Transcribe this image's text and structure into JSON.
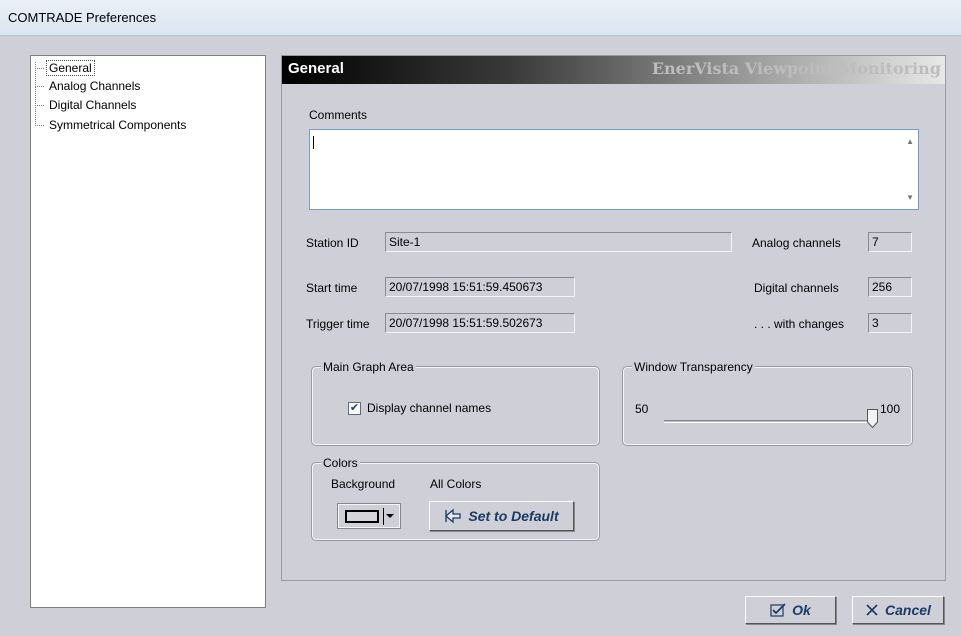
{
  "window": {
    "title": "COMTRADE Preferences"
  },
  "tree": {
    "items": [
      {
        "label": "General"
      },
      {
        "label": "Analog Channels"
      },
      {
        "label": "Digital Channels"
      },
      {
        "label": "Symmetrical Components"
      }
    ]
  },
  "banner": {
    "title": "General",
    "brand": "EnerVista Viewpoint Monitoring"
  },
  "comments": {
    "label": "Comments",
    "value": ""
  },
  "station": {
    "label": "Station ID",
    "value": "Site-1"
  },
  "start": {
    "label": "Start time",
    "value": "20/07/1998 15:51:59.450673"
  },
  "trigger": {
    "label": "Trigger time",
    "value": "20/07/1998 15:51:59.502673"
  },
  "analog": {
    "label": "Analog channels",
    "value": "7"
  },
  "digital": {
    "label": "Digital channels",
    "value": "256"
  },
  "changes": {
    "label": ". . . with changes",
    "value": "3"
  },
  "main_graph": {
    "legend": "Main Graph Area",
    "display_names_label": "Display channel names",
    "display_names_checked": true
  },
  "transparency": {
    "legend": "Window Transparency",
    "min_label": "50",
    "max_label": "100",
    "min": 50,
    "max": 100,
    "value": 100
  },
  "colors": {
    "legend": "Colors",
    "background_label": "Background",
    "all_colors_label": "All Colors",
    "default_button": "Set to Default"
  },
  "buttons": {
    "ok": "Ok",
    "cancel": "Cancel"
  },
  "icons": {
    "checkbox": "check-icon",
    "default": "arrow-back-icon",
    "ok": "check-mark-icon",
    "cancel": "close-icon"
  }
}
